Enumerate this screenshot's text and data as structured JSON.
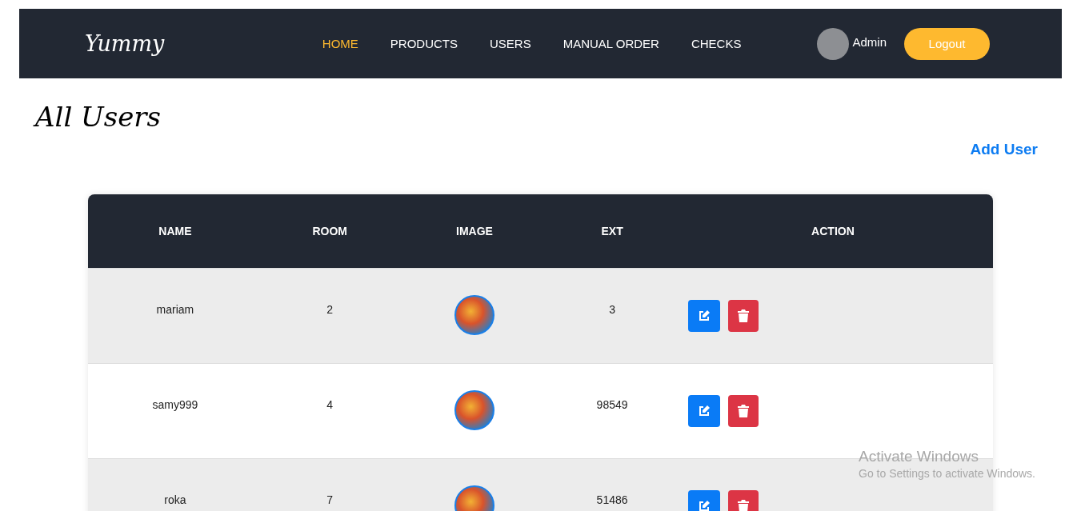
{
  "navbar": {
    "logo": "Yummy",
    "links": [
      {
        "label": "HOME",
        "selected": true
      },
      {
        "label": "PRODUCTS",
        "selected": false
      },
      {
        "label": "USERS",
        "selected": false
      },
      {
        "label": "MANUAL ORDER",
        "selected": false
      },
      {
        "label": "CHECKS",
        "selected": false
      }
    ],
    "user_name": "Admin",
    "logout": "Logout"
  },
  "page_title": "All Users",
  "add_user": "Add User",
  "table": {
    "columns": [
      "NAME",
      "ROOM",
      "IMAGE",
      "EXT",
      "ACTION"
    ],
    "rows": [
      {
        "name": "mariam",
        "room": "2",
        "ext": "3"
      },
      {
        "name": "samy999",
        "room": "4",
        "ext": "98549"
      },
      {
        "name": "roka",
        "room": "7",
        "ext": "51486"
      }
    ]
  },
  "os_notice": {
    "title": "Activate Windows",
    "subtitle": "Go to Settings to activate Windows."
  }
}
